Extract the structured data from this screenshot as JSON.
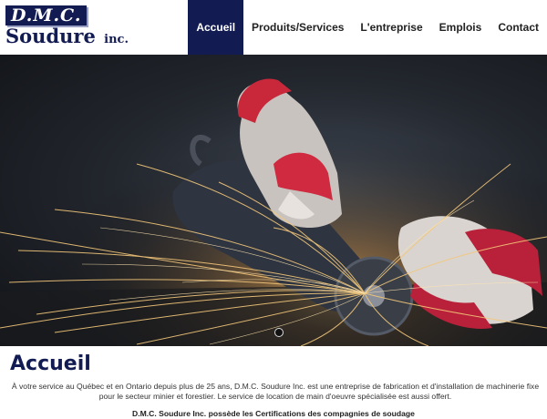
{
  "logo": {
    "line1": "D.M.C.",
    "line2": "Soudure",
    "suffix": "inc."
  },
  "nav": {
    "items": [
      {
        "label": "Accueil",
        "active": true
      },
      {
        "label": "Produits/Services",
        "active": false
      },
      {
        "label": "L'entreprise",
        "active": false
      },
      {
        "label": "Emplois",
        "active": false
      },
      {
        "label": "Contact",
        "active": false
      }
    ]
  },
  "hero": {
    "slides_total": 1,
    "current_slide": 1
  },
  "main": {
    "title": "Accueil",
    "intro": "À votre service au Québec et en Ontario depuis plus de 25 ans, D.M.C. Soudure Inc. est une entreprise de fabrication et d'installation de machinerie fixe pour le secteur minier et forestier. Le service de location de main d'oeuvre spécialisée est aussi offert.",
    "certifications": "D.M.C. Soudure Inc. possède les Certifications des compagnies de soudage"
  },
  "colors": {
    "brand": "#131c52",
    "text": "#333333",
    "background": "#ffffff"
  }
}
